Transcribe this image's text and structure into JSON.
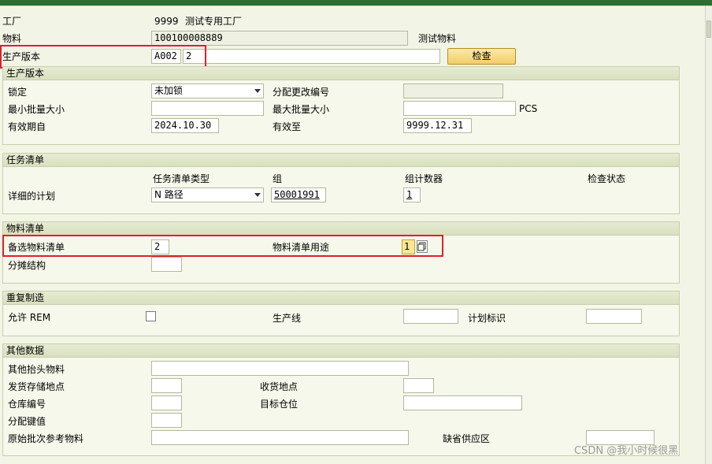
{
  "header": {
    "plant_label": "工厂",
    "plant_code": "9999",
    "plant_name": "测试专用工厂",
    "material_label": "物料",
    "material_value": "100100008889",
    "material_desc": "测试物料",
    "prod_version_label": "生产版本",
    "prod_version_code": "A002",
    "prod_version_text": "2",
    "check_button": "检查"
  },
  "sec_prod_version": {
    "title": "生产版本",
    "lock_label": "锁定",
    "lock_value": "未加锁",
    "change_no_label": "分配更改编号",
    "min_lot_label": "最小批量大小",
    "max_lot_label": "最大批量大小",
    "unit": "PCS",
    "valid_from_label": "有效期自",
    "valid_from": "2024.10.30",
    "valid_to_label": "有效至",
    "valid_to": "9999.12.31"
  },
  "sec_routing": {
    "title": "任务清单",
    "col_type": "任务清单类型",
    "col_group": "组",
    "col_counter": "组计数器",
    "col_check": "检查状态",
    "row_label": "详细的计划",
    "type_value": "N 路径",
    "group_value": "50001991",
    "counter_value": "1"
  },
  "sec_bom": {
    "title": "物料清单",
    "alt_bom_label": "备选物料清单",
    "alt_bom_value": "2",
    "usage_label": "物料清单用途",
    "usage_value": "1",
    "apportion_label": "分摊结构"
  },
  "sec_repetitive": {
    "title": "重复制造",
    "allow_rem_label": "允许 REM",
    "prod_line_label": "生产线",
    "plan_id_label": "计划标识"
  },
  "sec_other": {
    "title": "其他数据",
    "other_header_label": "其他抬头物料",
    "issue_sloc_label": "发货存储地点",
    "receive_loc_label": "收货地点",
    "warehouse_label": "仓库编号",
    "target_bin_label": "目标仓位",
    "dist_key_label": "分配键值",
    "orig_batch_label": "原始批次参考物料",
    "default_supply_label": "缺省供应区"
  },
  "watermark": "CSDN @我小时候很黑"
}
